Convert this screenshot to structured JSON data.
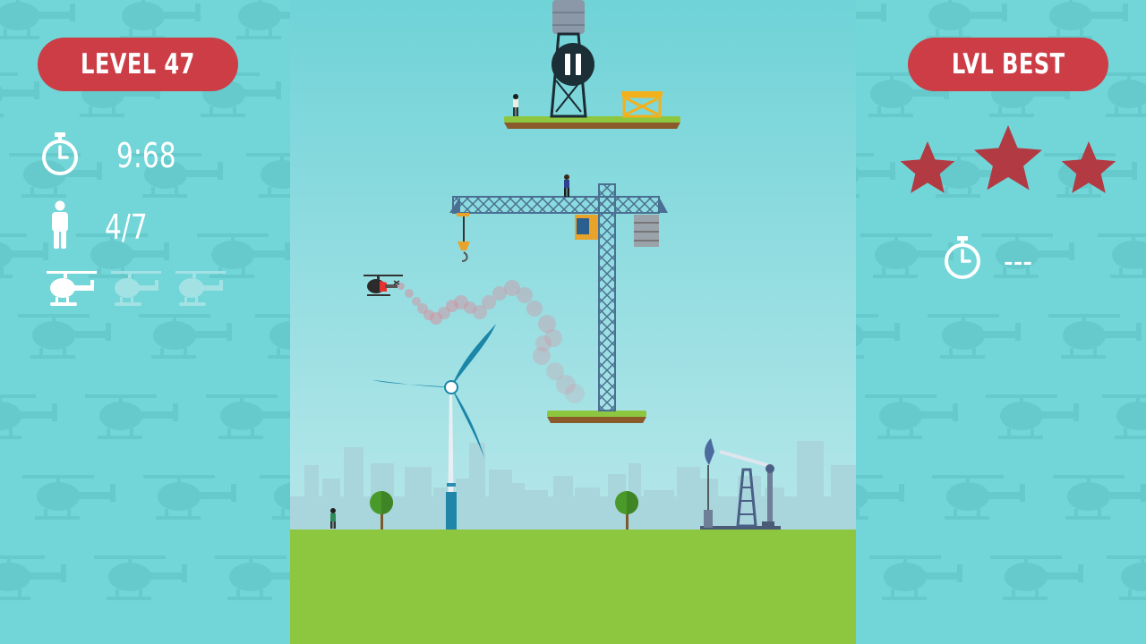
{
  "hud": {
    "level_label": "LEVEL 47",
    "timer_value": "9:68",
    "rescued_count": "4/7",
    "helicopter_lives": [
      {
        "state": "active"
      },
      {
        "state": "lost"
      },
      {
        "state": "lost"
      }
    ],
    "timer_icon": "stopwatch-icon",
    "person_icon": "person-icon",
    "life_icon": "helicopter-icon"
  },
  "best": {
    "label": "LVL BEST",
    "stars_earned": 3,
    "stars_total": 3,
    "best_time": "---",
    "timer_icon": "stopwatch-icon"
  },
  "colors": {
    "background": "#72d5d7",
    "pill": "#cd3d46",
    "star": "#b23a43",
    "ground": "#8dc63f",
    "sky": "#b1e4ea"
  }
}
